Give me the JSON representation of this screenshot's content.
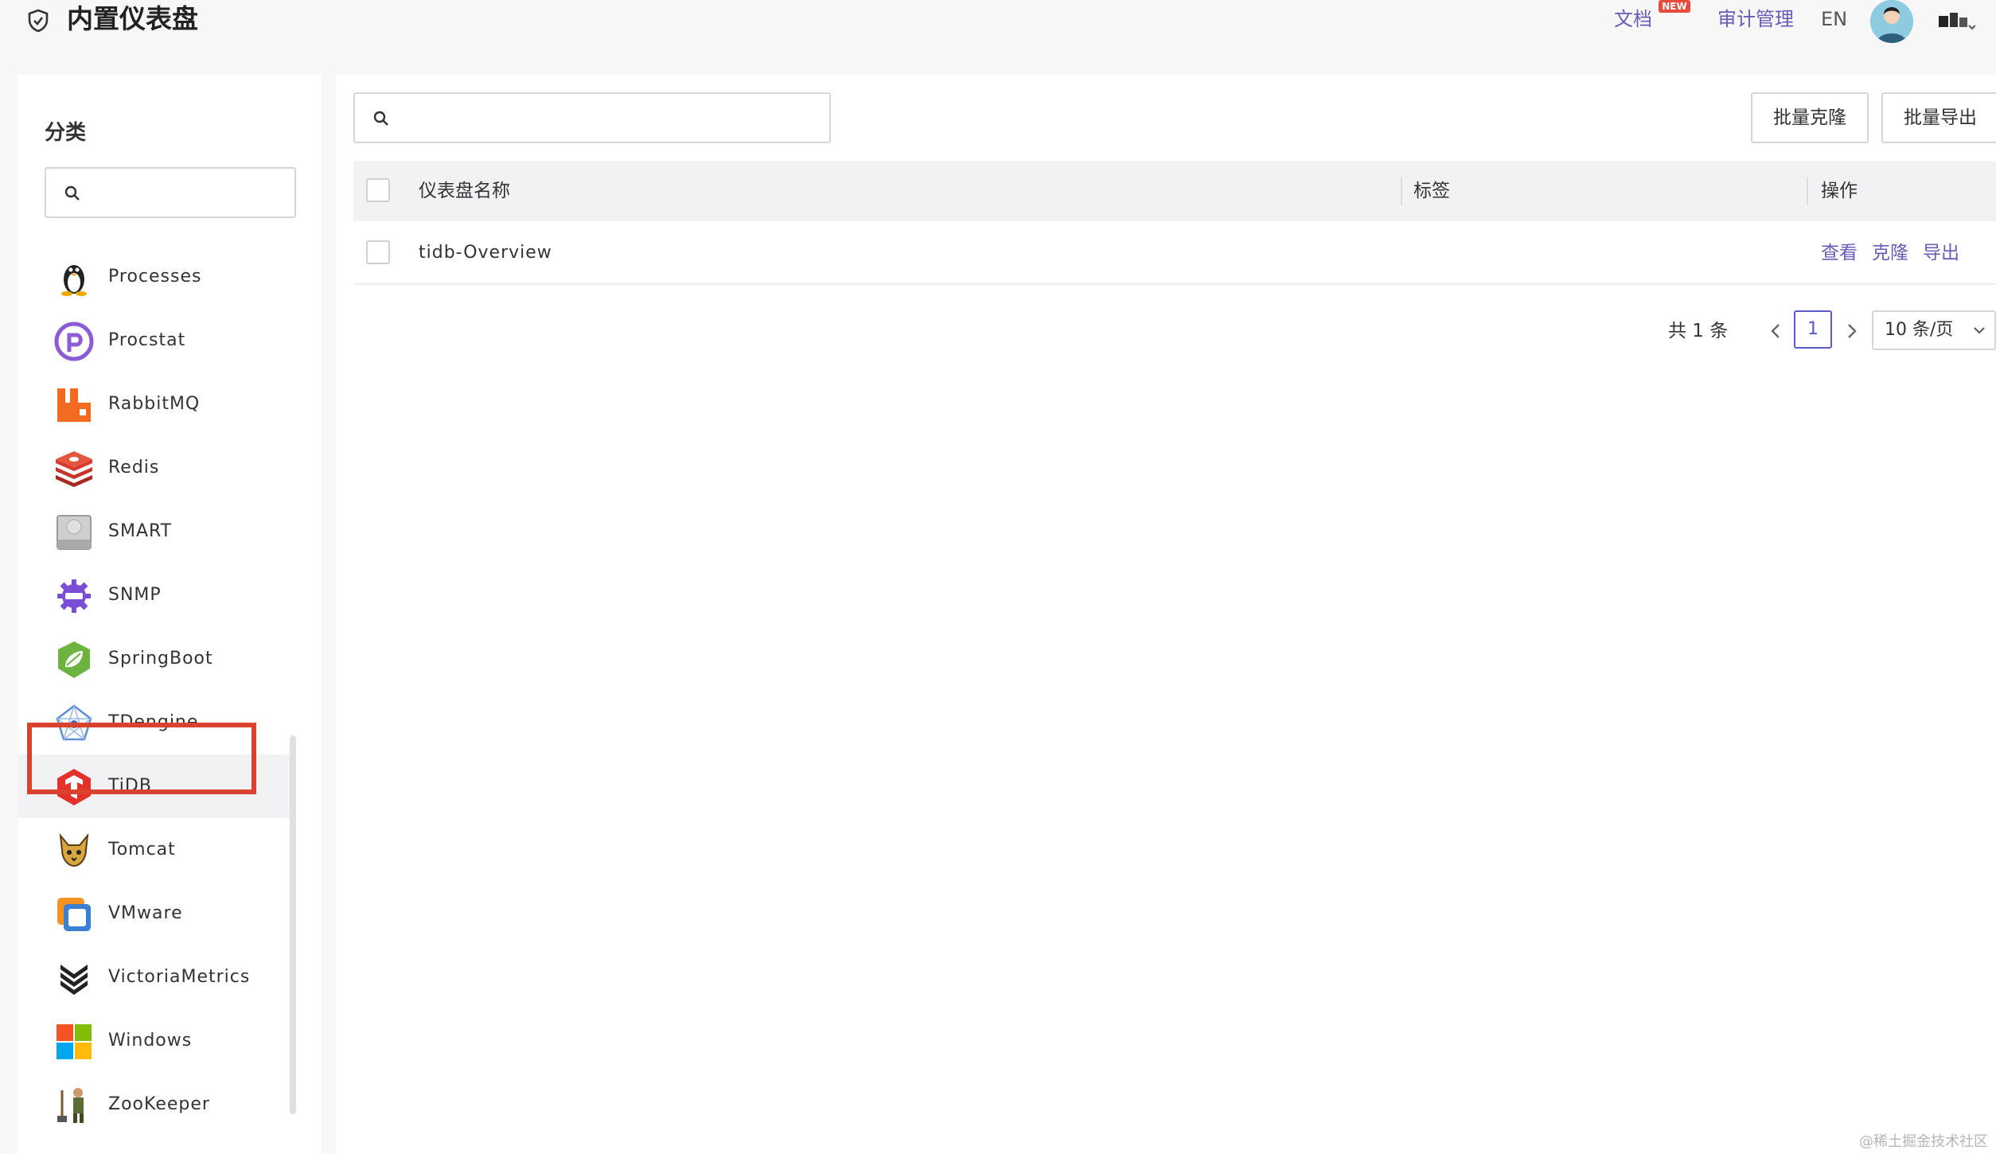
{
  "header": {
    "title": "内置仪表盘",
    "docs": "文档",
    "new_badge": "NEW",
    "audit": "审计管理",
    "lang": "EN"
  },
  "sidebar": {
    "heading": "分类",
    "search_placeholder": "",
    "items": [
      {
        "label": "Processes",
        "icon": "linux-penguin-icon"
      },
      {
        "label": "Procstat",
        "icon": "procstat-icon"
      },
      {
        "label": "RabbitMQ",
        "icon": "rabbitmq-icon"
      },
      {
        "label": "Redis",
        "icon": "redis-icon"
      },
      {
        "label": "SMART",
        "icon": "harddisk-icon"
      },
      {
        "label": "SNMP",
        "icon": "snmp-icon"
      },
      {
        "label": "SpringBoot",
        "icon": "springboot-icon"
      },
      {
        "label": "TDengine",
        "icon": "tdengine-icon"
      },
      {
        "label": "TiDB",
        "icon": "tidb-icon",
        "selected": true
      },
      {
        "label": "Tomcat",
        "icon": "tomcat-icon"
      },
      {
        "label": "VMware",
        "icon": "vmware-icon"
      },
      {
        "label": "VictoriaMetrics",
        "icon": "victoriametrics-icon"
      },
      {
        "label": "Windows",
        "icon": "windows-icon"
      },
      {
        "label": "ZooKeeper",
        "icon": "zookeeper-icon"
      }
    ]
  },
  "main": {
    "search_placeholder": "",
    "batch_clone": "批量克隆",
    "batch_export": "批量导出",
    "table": {
      "headers": {
        "name": "仪表盘名称",
        "tags": "标签",
        "actions": "操作"
      },
      "rows": [
        {
          "name": "tidb-Overview",
          "tags": "",
          "view": "查看",
          "clone": "克隆",
          "export": "导出"
        }
      ]
    },
    "pagination": {
      "total": "共 1 条",
      "current": "1",
      "page_size": "10 条/页"
    }
  },
  "watermark": "@稀土掘金技术社区",
  "colors": {
    "accent": "#6a5bb8",
    "highlight": "#d9432e"
  }
}
